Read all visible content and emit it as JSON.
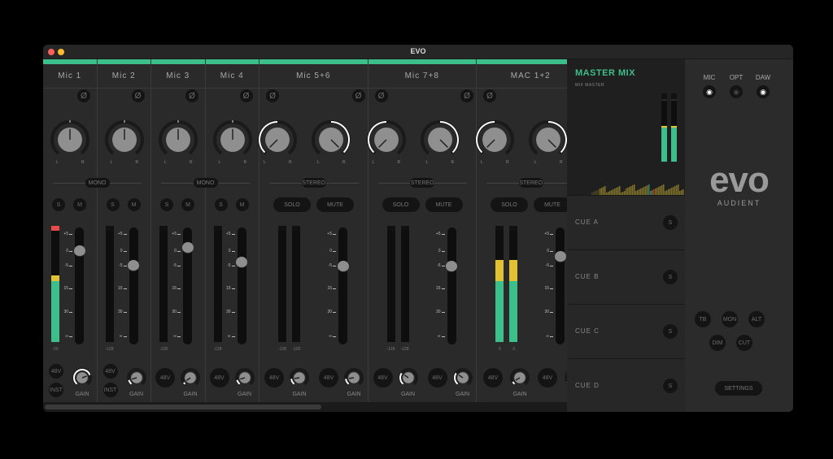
{
  "window": {
    "title": "EVO"
  },
  "accent": "#3dbf8c",
  "channels": [
    {
      "name": "Mic 1",
      "type": "mono",
      "pan": [
        0
      ],
      "fader_db": 0,
      "meters": [
        0.6
      ],
      "clip": true,
      "meter_labels": [
        "-26"
      ],
      "has_inst": true,
      "gain": [
        0.75
      ],
      "link_label": "MONO"
    },
    {
      "name": "Mic 2",
      "type": "mono",
      "pan": [
        0
      ],
      "fader_db": -5,
      "meters": [
        0
      ],
      "clip": false,
      "meter_labels": [
        "-128"
      ],
      "has_inst": true,
      "gain": [
        0.12
      ]
    },
    {
      "name": "Mic 3",
      "type": "mono",
      "pan": [
        0
      ],
      "fader_db": 1,
      "meters": [
        0
      ],
      "clip": false,
      "meter_labels": [
        "-128"
      ],
      "has_inst": false,
      "gain": [
        0.05
      ],
      "link_label": "MONO"
    },
    {
      "name": "Mic 4",
      "type": "mono",
      "pan": [
        0
      ],
      "fader_db": -4,
      "meters": [
        0
      ],
      "clip": false,
      "meter_labels": [
        "-128"
      ],
      "has_inst": false,
      "gain": [
        0.12
      ]
    },
    {
      "name": "Mic 5+6",
      "type": "stereo",
      "pan": [
        -100,
        100
      ],
      "fader_db": -5.5,
      "meters": [
        0,
        0
      ],
      "meter_labels": [
        "-128",
        "-128"
      ],
      "gain": [
        0.15,
        0.15
      ],
      "link_label": "STEREO"
    },
    {
      "name": "Mic 7+8",
      "type": "stereo",
      "pan": [
        -100,
        100
      ],
      "fader_db": -5.5,
      "meters": [
        0,
        0
      ],
      "meter_labels": [
        "-128",
        "-128"
      ],
      "gain": [
        0.3,
        0.3
      ],
      "link_label": "STEREO"
    },
    {
      "name": "MAC 1+2",
      "type": "stereo",
      "pan": [
        -100,
        100
      ],
      "fader_db": -2,
      "meters": [
        0.74,
        0.74
      ],
      "meter_labels": [
        "-5",
        "-3"
      ],
      "gain": [],
      "link_label": "STEREO"
    }
  ],
  "labels": {
    "phase": "Ø",
    "l": "L",
    "r": "R",
    "solo_short": "S",
    "mute_short": "M",
    "solo": "SOLO",
    "mute": "MUTE",
    "phantom": "48V",
    "inst": "INST",
    "gain": "GAIN"
  },
  "scale_ticks": [
    "+5",
    "0",
    "-5",
    "15",
    "30",
    "∞"
  ],
  "master": {
    "title": "MASTER MIX",
    "subtitle": "MIX MASTER",
    "meters": [
      0.6,
      0.6
    ],
    "cues": [
      {
        "name": "CUE A",
        "solo": "S"
      },
      {
        "name": "CUE B",
        "solo": "S"
      },
      {
        "name": "CUE C",
        "solo": "S"
      },
      {
        "name": "CUE D",
        "solo": "S"
      }
    ]
  },
  "right": {
    "inputs": [
      {
        "label": "MIC",
        "visible": true
      },
      {
        "label": "OPT",
        "visible": false
      },
      {
        "label": "DAW",
        "visible": true
      }
    ],
    "logo": "evo",
    "brand": "AUDIENT",
    "monitor_buttons": [
      "TB",
      "MON",
      "ALT",
      "DIM",
      "CUT"
    ],
    "settings": "SETTINGS"
  },
  "colors": {
    "meter_green": "#3dbf8c",
    "meter_yellow": "#e0c234",
    "clip_red": "#e84b4b",
    "title_green": "#3dbf8c"
  }
}
